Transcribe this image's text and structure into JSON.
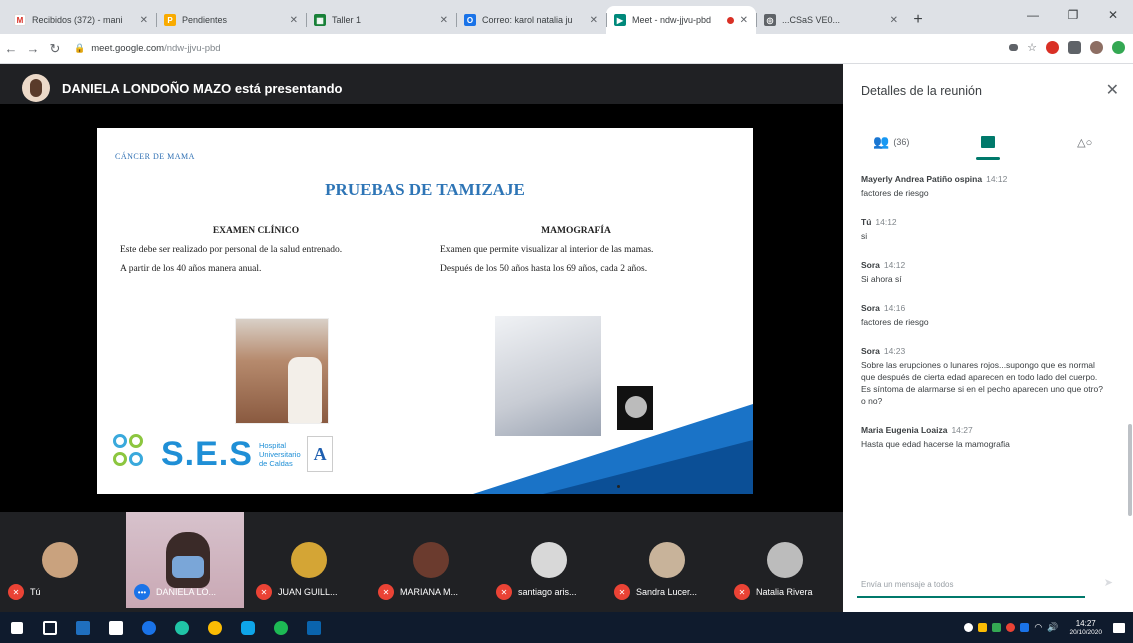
{
  "browser": {
    "tabs": [
      {
        "title": "Recibidos (372) - mani",
        "favicon": "gmail-icon",
        "color": "#d93025",
        "active": false
      },
      {
        "title": "Pendientes",
        "favicon": "tasks-icon",
        "color": "#f9ab00",
        "active": false
      },
      {
        "title": "Taller 1",
        "favicon": "sheets-icon",
        "color": "#188038",
        "active": false
      },
      {
        "title": "Correo: karol natalia ju",
        "favicon": "outlook-icon",
        "color": "#1a73e8",
        "active": false
      },
      {
        "title": "Meet - ndw-jjvu-pbd",
        "favicon": "meet-icon",
        "color": "#00897b",
        "active": true
      },
      {
        "title": "...CSaS VE0...",
        "favicon": "globe-icon",
        "color": "#5f6368",
        "active": false
      }
    ],
    "url_host": "meet.google.com",
    "url_path": "/ndw-jjvu-pbd"
  },
  "presenter": {
    "name_text": "DANIELA LONDOÑO MAZO está presentando"
  },
  "slide": {
    "kicker": "CÁNCER DE MAMA",
    "title": "PRUEBAS DE TAMIZAJE",
    "left": {
      "heading": "EXAMEN CLÍNICO",
      "p1": "Este debe ser realizado por personal de la salud entrenado.",
      "p2": "A partir de los 40 años manera anual."
    },
    "right": {
      "heading": "MAMOGRAFÍA",
      "p1": "Examen que permite visualizar al interior de las mamas.",
      "p2": "Después de los 50 años hasta los 69 años, cada 2 años."
    },
    "logo_big": "S.E.S",
    "logo_l1": "Hospital",
    "logo_l2": "Universitario",
    "logo_l3": "de Caldas"
  },
  "panel": {
    "title": "Detalles de la reunión",
    "people_count": "(36)",
    "messages": [
      {
        "author": "Mayerly Andrea Patiño ospina",
        "time": "14:12",
        "text": "factores de riesgo"
      },
      {
        "author": "Tú",
        "time": "14:12",
        "text": "si"
      },
      {
        "author": "Sora",
        "time": "14:12",
        "text": "Si ahora sí"
      },
      {
        "author": "Sora",
        "time": "14:16",
        "text": "factores de riesgo"
      },
      {
        "author": "Sora",
        "time": "14:23",
        "text": "Sobre las erupciones o lunares rojos...supongo que es normal que después de cierta edad aparecen en todo lado del cuerpo. Es síntoma de alarmarse si en el pecho aparecen uno que otro? o no?"
      },
      {
        "author": "Maria Eugenia Loaiza",
        "time": "14:27",
        "text": "Hasta que edad hacerse la mamografia"
      }
    ],
    "compose_placeholder": "Envía un mensaje a todos"
  },
  "participants": [
    {
      "label": "Tú",
      "face": "#c9a27e"
    },
    {
      "label": "DANIELA LO...",
      "face": "video"
    },
    {
      "label": "JUAN GUILL...",
      "face": "#d4a535"
    },
    {
      "label": "MARIANA M...",
      "face": "#6b3b2e"
    },
    {
      "label": "santiago aris...",
      "face": "#d8d8d8"
    },
    {
      "label": "Sandra Lucer...",
      "face": "#c8b39a"
    },
    {
      "label": "Natalia Rivera",
      "face": "#bcbcbc"
    }
  ],
  "taskbar": {
    "time": "14:27",
    "date": "20/10/2020"
  }
}
